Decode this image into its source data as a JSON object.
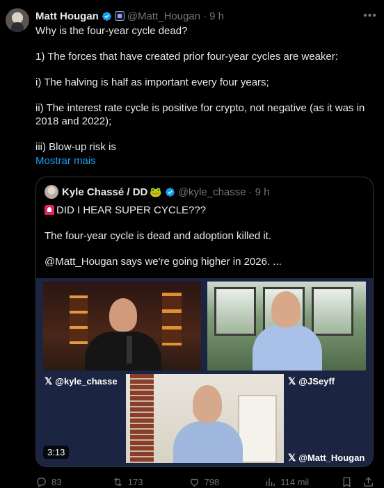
{
  "author": {
    "name": "Matt Hougan",
    "handle": "@Matt_Hougan",
    "separator": "·",
    "time": "9 h"
  },
  "body": {
    "paragraphs": [
      "Why is the four-year cycle dead?",
      "1) The forces that have created prior four-year cycles are weaker:",
      "i) The halving is half as important every four years;",
      "ii) The interest rate cycle is positive for crypto, not negative (as it was in 2018 and 2022);",
      "iii) Blow-up risk is"
    ],
    "show_more": "Mostrar mais"
  },
  "quote": {
    "name": "Kyle Chassé / DD",
    "handle": "@kyle_chasse",
    "separator": "·",
    "time": "9 h",
    "paragraphs": [
      "DID I HEAR SUPER CYCLE???",
      "The four-year cycle is dead and adoption killed it.",
      "@Matt_Hougan says we're going higher in 2026. ..."
    ],
    "video": {
      "labels": [
        "@kyle_chasse",
        "@JSeyff",
        "@Matt_Hougan"
      ],
      "duration": "3:13"
    }
  },
  "actions": {
    "replies": "83",
    "reposts": "173",
    "likes": "798",
    "views": "114 mil"
  },
  "colors": {
    "background": "#000000",
    "text": "#e7e9ea",
    "muted": "#71767b",
    "link": "#1d9bf0",
    "verified": "#1d9bf0"
  }
}
